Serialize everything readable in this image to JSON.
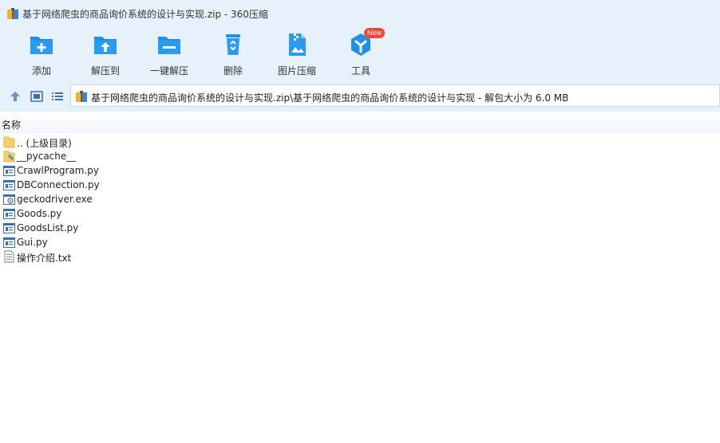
{
  "window": {
    "title": "基于网络爬虫的商品询价系统的设计与实现.zip - 360压缩"
  },
  "toolbar": {
    "items": [
      {
        "label": "添加",
        "icon": "add-icon"
      },
      {
        "label": "解压到",
        "icon": "extract-to-icon"
      },
      {
        "label": "一键解压",
        "icon": "one-click-extract-icon"
      },
      {
        "label": "删除",
        "icon": "delete-icon"
      },
      {
        "label": "图片压缩",
        "icon": "image-compress-icon"
      },
      {
        "label": "工具",
        "icon": "tools-icon",
        "badge": "New"
      }
    ]
  },
  "navbar": {
    "path": "基于网络爬虫的商品询价系统的设计与实现.zip\\基于网络爬虫的商品询价系统的设计与实现 - 解包大小为 6.0 MB"
  },
  "list": {
    "column_name": "名称",
    "files": [
      {
        "name": ".. (上级目录)",
        "type": "folder"
      },
      {
        "name": "__pycache__",
        "type": "folder-special"
      },
      {
        "name": "CrawlProgram.py",
        "type": "py"
      },
      {
        "name": "DBConnection.py",
        "type": "py"
      },
      {
        "name": "geckodriver.exe",
        "type": "exe"
      },
      {
        "name": "Goods.py",
        "type": "py"
      },
      {
        "name": "GoodsList.py",
        "type": "py"
      },
      {
        "name": "Gui.py",
        "type": "py"
      },
      {
        "name": "操作介绍.txt",
        "type": "txt"
      }
    ]
  },
  "colors": {
    "toolbar_bg": "#e6f1fc",
    "accent_blue": "#1e90e8",
    "badge_red": "#f0453c"
  }
}
